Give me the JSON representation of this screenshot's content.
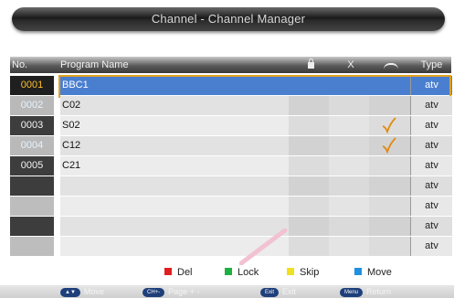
{
  "window": {
    "title": "Channel - Channel Manager"
  },
  "header": {
    "no_label": "No.",
    "program_label": "Program Name",
    "lock_icon": "lock-icon",
    "del_label": "X",
    "skip_icon": "skip-arc-icon",
    "type_label": "Type"
  },
  "rows": [
    {
      "no": "0001",
      "name": "BBC1",
      "type": "atv",
      "skip": false,
      "selected": true
    },
    {
      "no": "0002",
      "name": "C02",
      "type": "atv",
      "skip": false,
      "selected": false
    },
    {
      "no": "0003",
      "name": "S02",
      "type": "atv",
      "skip": true,
      "selected": false
    },
    {
      "no": "0004",
      "name": "C12",
      "type": "atv",
      "skip": true,
      "selected": false
    },
    {
      "no": "0005",
      "name": "C21",
      "type": "atv",
      "skip": false,
      "selected": false
    },
    {
      "no": "",
      "name": "",
      "type": "atv",
      "skip": false,
      "selected": false
    },
    {
      "no": "",
      "name": "",
      "type": "atv",
      "skip": false,
      "selected": false
    },
    {
      "no": "",
      "name": "",
      "type": "atv",
      "skip": false,
      "selected": false
    },
    {
      "no": "",
      "name": "",
      "type": "atv",
      "skip": false,
      "selected": false
    }
  ],
  "legend": {
    "del": {
      "label": "Del",
      "color": "#e02020"
    },
    "lock": {
      "label": "Lock",
      "color": "#20b040"
    },
    "skip": {
      "label": "Skip",
      "color": "#f0e020"
    },
    "move": {
      "label": "Move",
      "color": "#2090e0"
    }
  },
  "hints": {
    "move": {
      "key": "▲▼",
      "label": "Move"
    },
    "page": {
      "key": "CH+-",
      "label": "Page + -"
    },
    "exit": {
      "key": "Exit",
      "label": "Exit"
    },
    "return": {
      "key": "Menu",
      "label": "Return"
    }
  },
  "colors": {
    "selection": "#4a7fd0",
    "selection_border": "#e0a020",
    "check": "#e08a10"
  }
}
